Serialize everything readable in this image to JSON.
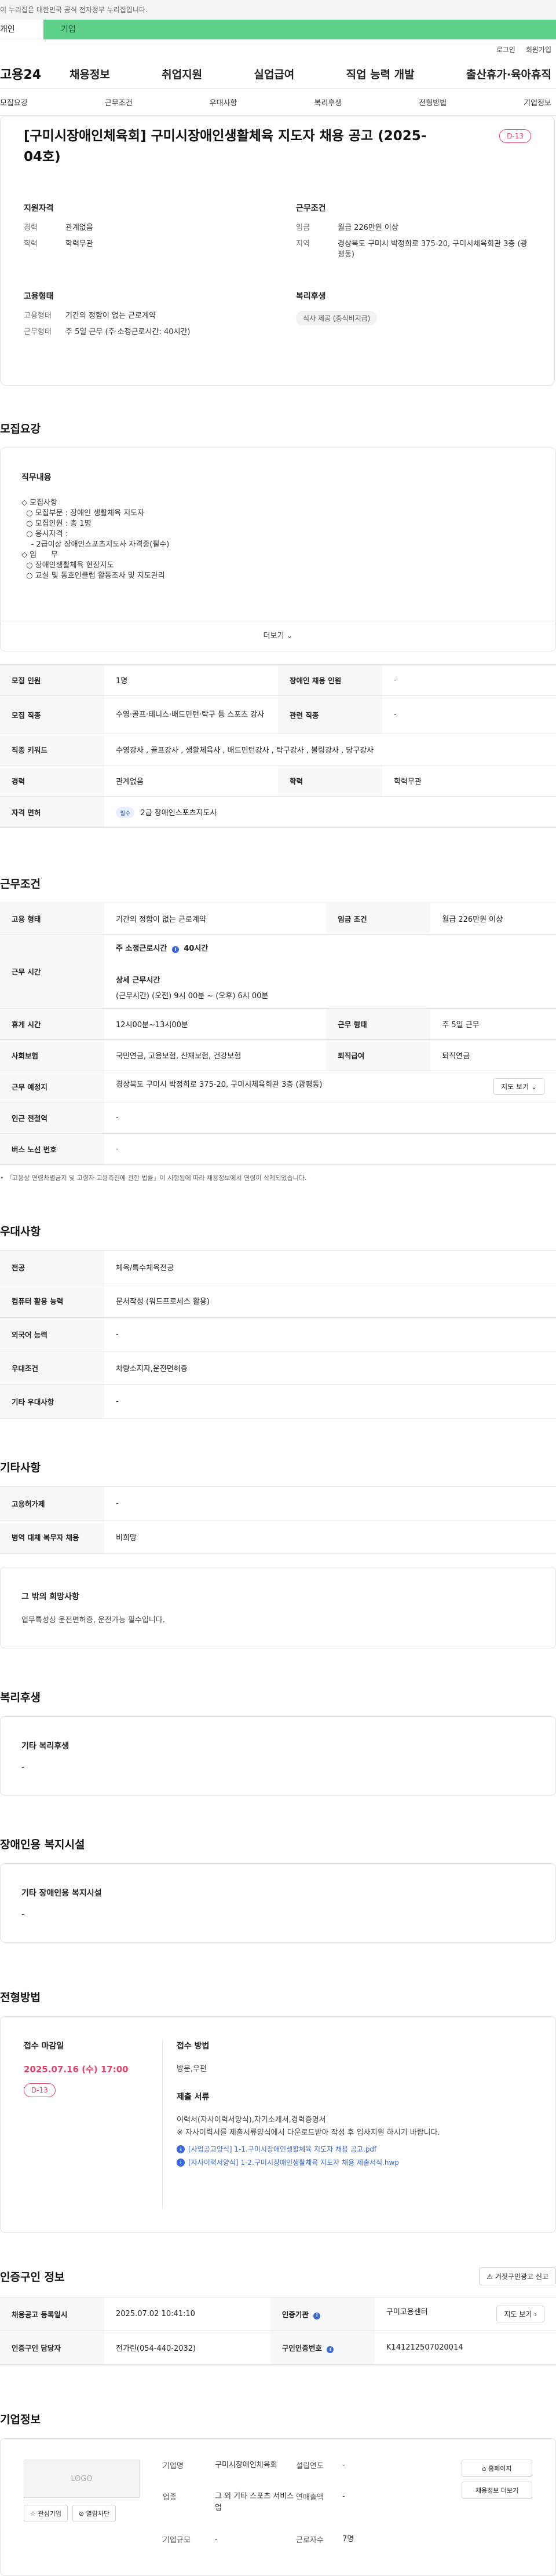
{
  "notice": "이 누리집은 대한민국 공식 전자정부 누리집입니다.",
  "member_tabs": {
    "individual": "개인",
    "corporate": "기업"
  },
  "util": {
    "login": "로그인",
    "signup": "회원가입"
  },
  "logo": "고용24",
  "gnb": [
    "채용정보",
    "취업지원",
    "실업급여",
    "직업 능력 개발",
    "출산휴가·육아휴직"
  ],
  "subnav": [
    "모집요강",
    "근무조건",
    "우대사항",
    "복리후생",
    "전형방법",
    "기업정보"
  ],
  "summary": {
    "title": "[구미시장애인체육회] 구미시장애인생활체육 지도자 채용 공고 (2025-04호)",
    "dday": "D-13",
    "qualification": {
      "heading": "지원자격",
      "rows": [
        {
          "k": "경력",
          "v": "관계없음"
        },
        {
          "k": "학력",
          "v": "학력무관"
        }
      ]
    },
    "conditions": {
      "heading": "근무조건",
      "rows": [
        {
          "k": "임금",
          "v": "월급 226만원 이상"
        },
        {
          "k": "지역",
          "v": "경상북도 구미시 박정희로 375-20, 구미시체육회관 3층 (광평동)"
        }
      ]
    },
    "employment": {
      "heading": "고용형태",
      "rows": [
        {
          "k": "고용형태",
          "v": "기간의 정함이 없는 근로계약"
        },
        {
          "k": "근무형태",
          "v": "주 5일 근무 (주 소정근로시간: 40시간)"
        }
      ]
    },
    "welfare": {
      "heading": "복리후생",
      "pill": "식사 제공 (중식비지급)"
    }
  },
  "recruit": {
    "title": "모집요강",
    "detail_heading": "직무내용",
    "detail_lines": [
      "◇ 모집사항",
      "  ○ 모집부문 : 장애인 생활체육 지도자",
      "  ○ 모집인원 : 총 1명",
      "  ○ 응시자격 :",
      "    - 2급이상 장애인스포츠지도사 자격증(필수)",
      "",
      "◇ 임      무",
      "  ○ 장애인생활체육 현장지도",
      "  ○ 교실 및 동호인클럽 활동조사 및 지도관리"
    ],
    "more": "더보기",
    "table": [
      {
        "k1": "모집 인원",
        "v1": "1명",
        "k2": "장애인 채용 인원",
        "v2": "-"
      },
      {
        "k1": "모집 직종",
        "v1": "수영·골프·테니스·배드민턴·탁구 등 스포츠 강사",
        "k2": "관련 직종",
        "v2": "-"
      },
      {
        "k1": "직종 키워드",
        "v1": "수영강사 , 골프강사 , 생활체육사 , 배드민턴강사 , 탁구강사 , 볼링강사 , 당구강사",
        "k2": "",
        "v2": ""
      },
      {
        "k1": "경력",
        "v1": "관계없음",
        "k2": "학력",
        "v2": "학력무관"
      },
      {
        "k1": "자격 면허",
        "v1": "2급 장애인스포츠지도사",
        "k2": "",
        "v2": "",
        "badge": "필수"
      }
    ]
  },
  "conditions": {
    "title": "근무조건",
    "employment_type": {
      "k": "고용 형태",
      "v": "기간의 정함이 없는 근로계약"
    },
    "wage": {
      "k": "임금 조건",
      "v": "월급 226만원 이상"
    },
    "hours": {
      "k": "근무 시간",
      "weekly_label": "주 소정근로시간",
      "weekly_value": "40시간",
      "detail_label": "상세 근무시간",
      "detail_value": "(근무시간) (오전) 9시 00분 ~ (오후) 6시 00분"
    },
    "break": {
      "k": "휴게 시간",
      "v": "12시00분~13시00분"
    },
    "form": {
      "k": "근무 형태",
      "v": "주 5일 근무"
    },
    "insurance": {
      "k": "사회보험",
      "v": "국민연금, 고용보험, 산재보험, 건강보험"
    },
    "retirement": {
      "k": "퇴직급여",
      "v": "퇴직연금"
    },
    "location": {
      "k": "근무 예정지",
      "v": "경상북도 구미시 박정희로 375-20, 구미시체육회관 3층 (광평동)",
      "btn": "지도 보기"
    },
    "subway": {
      "k": "인근 전철역",
      "v": "-"
    },
    "bus": {
      "k": "버스 노선 번호",
      "v": "-"
    },
    "footnote": "「고용상 연령차별금지 및 고령자 고용촉진에 관한 법률」이 시행됨에 따라 채용정보에서 연령이 삭제되었습니다."
  },
  "preference": {
    "title": "우대사항",
    "rows": [
      {
        "k": "전공",
        "v": "체육/특수체육전공"
      },
      {
        "k": "컴퓨터 활용 능력",
        "v": "문서작성 (워드프로세스 활용)"
      },
      {
        "k": "외국어 능력",
        "v": "-"
      },
      {
        "k": "우대조건",
        "v": "차량소지자,운전면허증"
      },
      {
        "k": "기타 우대사항",
        "v": "-"
      }
    ]
  },
  "etc": {
    "title": "기타사항",
    "rows": [
      {
        "k": "고용허가제",
        "v": "-"
      },
      {
        "k": "병역 대체 복무자 채용",
        "v": "비희망"
      }
    ],
    "other_heading": "그 밖의 희망사항",
    "other_text": "업무특성상 운전면허증, 운전가능 필수입니다."
  },
  "welfare": {
    "title": "복리후생",
    "heading": "기타 복리후생",
    "text": "-"
  },
  "facility": {
    "title": "장애인용 복지시설",
    "heading": "기타 장애인용 복지시설",
    "text": "-"
  },
  "apply": {
    "title": "전형방법",
    "deadline_heading": "접수 마감일",
    "deadline": "2025.07.16 (수) 17:00",
    "dday": "D-13",
    "method_heading": "접수 방법",
    "method": "방문,우편",
    "docs_heading": "제출 서류",
    "docs": "이력서(자사이력서양식),자기소개서,경력증명서",
    "docs_note": "※ 자사이력서를 제출서류양식에서 다운로드받아 작성 후 입사지원 하시기 바랍니다.",
    "files": [
      "[사업공고양식] 1-1.구미시장애인생활체육 지도자 채용 공고.pdf",
      "[자사이력서양식] 1-2.구미시장애인생활체육 지도자 채용 제출서식.hwp"
    ]
  },
  "agency": {
    "title": "인증구인 정보",
    "report": "거짓구인광고 신고",
    "rows": [
      {
        "k1": "채용공고 등록일시",
        "v1": "2025.07.02 10:41:10",
        "k2": "인증기관",
        "v2": "구미고용센터",
        "btn": "지도 보기"
      },
      {
        "k1": "인증구인 담당자",
        "v1": "전가린(054-440-2032)",
        "k2": "구인인증번호",
        "v2": "K141212507020014"
      }
    ]
  },
  "company": {
    "title": "기업정보",
    "logo": "LOGO",
    "interest": "관심기업",
    "block": "열람차단",
    "fields": [
      {
        "k": "기업명",
        "v": "구미시장애인체육회"
      },
      {
        "k": "설립연도",
        "v": "-"
      },
      {
        "k": "업종",
        "v": "그 외 기타 스포츠 서비스업"
      },
      {
        "k": "연매출액",
        "v": "-"
      },
      {
        "k": "기업규모",
        "v": "-"
      },
      {
        "k": "근로자수",
        "v": "7명"
      }
    ],
    "homepage": "홈페이지",
    "hire_info": "채용정보 더보기"
  }
}
